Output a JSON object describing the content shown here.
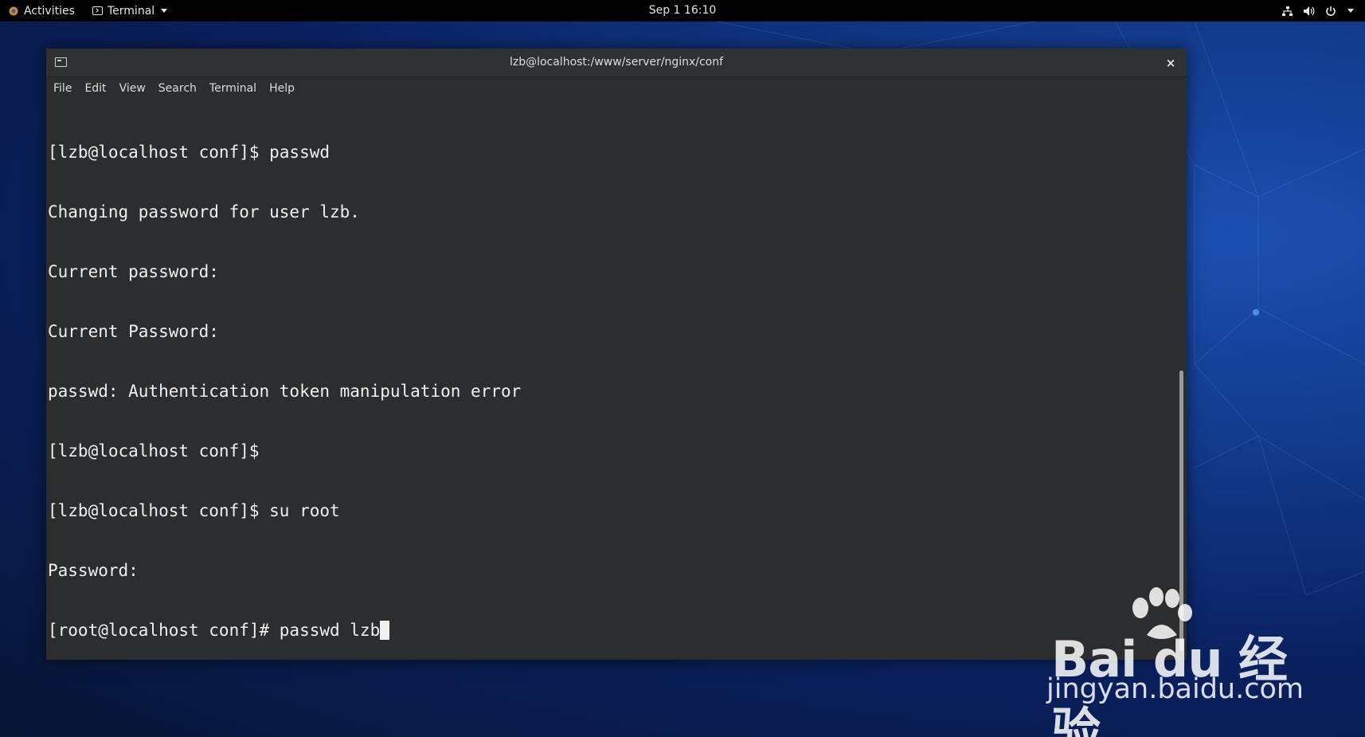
{
  "topbar": {
    "activities_label": "Activities",
    "app_menu_label": "Terminal",
    "clock": "Sep 1  16:10",
    "icons": [
      "network-icon",
      "volume-icon",
      "power-icon",
      "chevron-down-icon"
    ]
  },
  "window": {
    "title": "lzb@localhost:/www/server/nginx/conf",
    "close_glyph": "×",
    "menu": [
      {
        "label": "File"
      },
      {
        "label": "Edit"
      },
      {
        "label": "View"
      },
      {
        "label": "Search"
      },
      {
        "label": "Terminal"
      },
      {
        "label": "Help"
      }
    ],
    "scroll_position": 0.45
  },
  "terminal": {
    "lines": [
      "[lzb@localhost conf]$ passwd",
      "Changing password for user lzb.",
      "Current password:",
      "Current Password:",
      "passwd: Authentication token manipulation error",
      "[lzb@localhost conf]$",
      "[lzb@localhost conf]$ su root",
      "Password:",
      "[root@localhost conf]# passwd lzb"
    ]
  },
  "watermark": {
    "brand": "Bai du 经验",
    "url": "jingyan.baidu.com"
  },
  "colors": {
    "terminal_bg": "#2b2d2e",
    "terminal_fg": "#f0f0f0",
    "topbar_bg": "#000000",
    "desktop_accent": "#1b4fb0"
  }
}
